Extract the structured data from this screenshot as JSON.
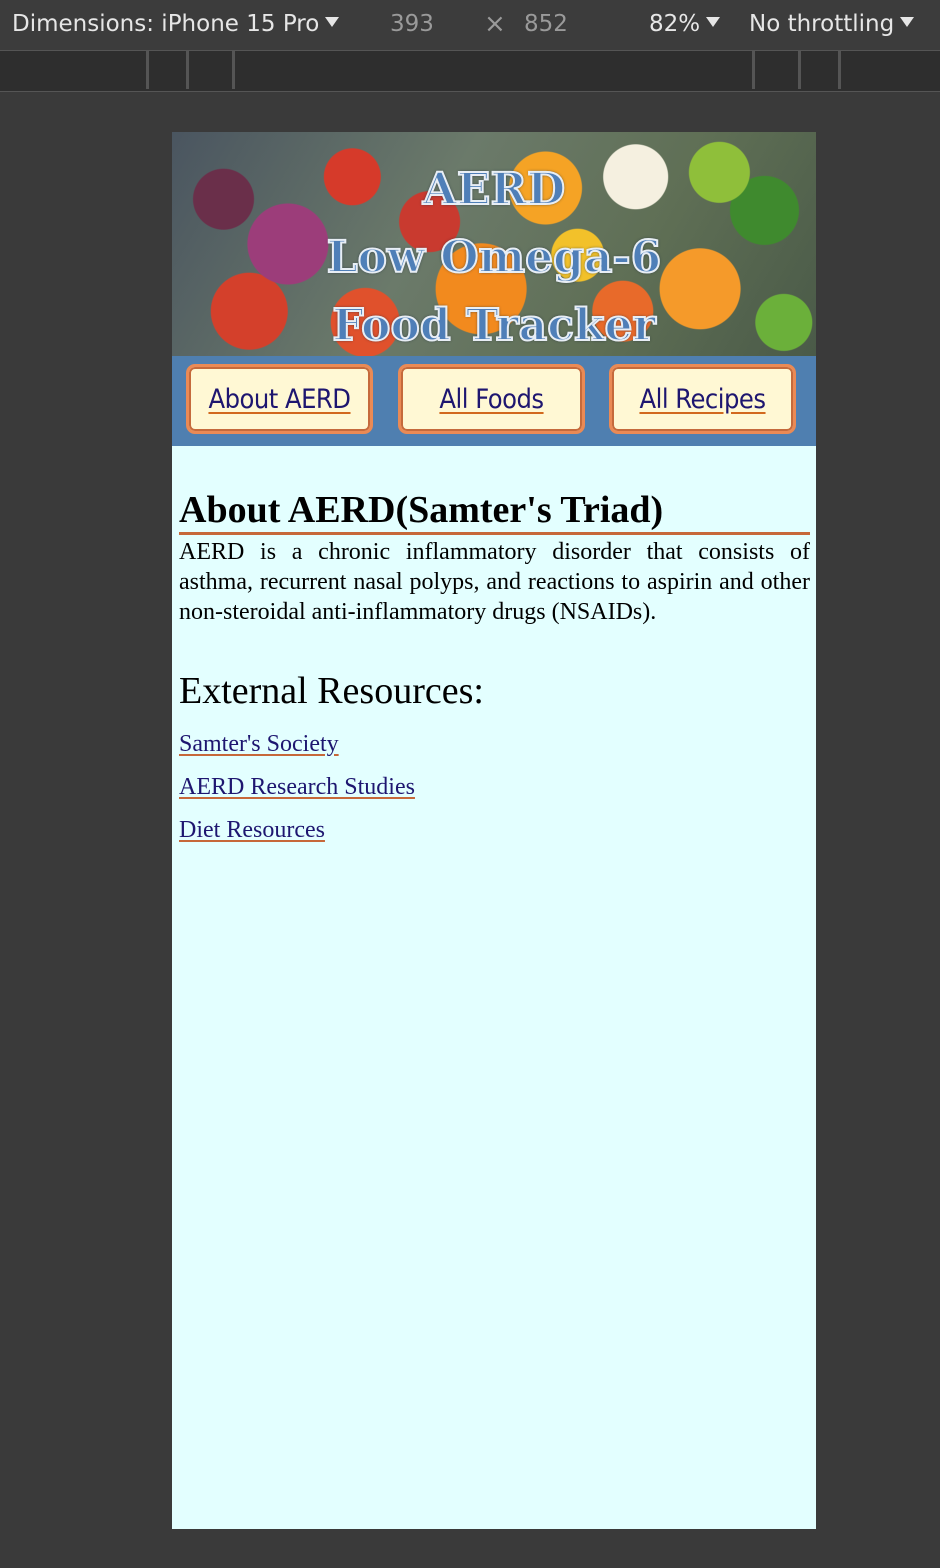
{
  "devtools": {
    "device_label": "Dimensions: iPhone 15 Pro",
    "width": "393",
    "times": "×",
    "height": "852",
    "zoom": "82%",
    "throttling": "No throttling"
  },
  "hero": {
    "title_line1": "AERD",
    "title_line2": "Low Omega-6",
    "title_line3": "Food Tracker"
  },
  "nav": {
    "items": [
      {
        "label": "About AERD"
      },
      {
        "label": "All Foods"
      },
      {
        "label": "All Recipes"
      }
    ]
  },
  "main": {
    "heading": "About AERD(Samter's Triad)",
    "description": "AERD is a chronic inflammatory disorder that consists of asthma, recurrent nasal polyps, and reactions to aspirin and other non-steroidal anti-inflammatory drugs (NSAIDs).",
    "resources_heading": "External Resources:",
    "links": [
      {
        "label": "Samter's Society"
      },
      {
        "label": "AERD Research Studies"
      },
      {
        "label": "Diet Resources"
      }
    ]
  },
  "colors": {
    "page_bg": "#e3ffff",
    "nav_bg": "#4f7fb0",
    "button_bg": "#fff8d4",
    "button_border": "#ea8a55",
    "link": "#1e1670",
    "accent": "#c6683a"
  }
}
